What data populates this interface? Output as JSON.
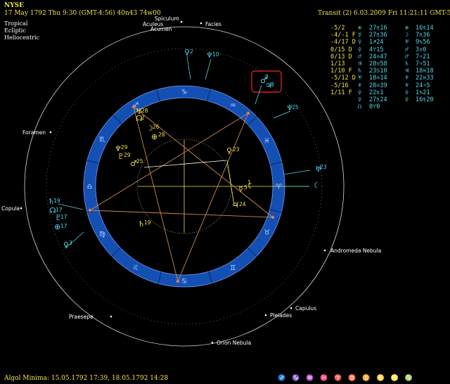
{
  "chart_header": {
    "name": "NYSE",
    "datetime": "17 May 1792   Thu    9:30 (GMT-4:56) 40n43  74w00",
    "options": [
      "Tropical",
      "Ecliptic",
      "Heliocentric"
    ]
  },
  "transit_header": "Transit (2)  6.03.2009  Fri 11:21:11 GMT-5",
  "transit_rows": [
    {
      "aspect": "-5/2",
      "tp": "⊕",
      "tpos": "27♏16",
      "np": "⊕",
      "npos": "16♏14"
    },
    {
      "aspect": "-4/-1 F",
      "tp": "☿",
      "tpos": "27♏36",
      "np": "☽",
      "npos": "7♏36"
    },
    {
      "aspect": "-4/17 D",
      "tp": "♀",
      "tpos": "1♐24",
      "np": "♅",
      "npos": "9♑56"
    },
    {
      "aspect": "0/15 D",
      "tp": "♀",
      "tpos": "4♈15",
      "np": "♂",
      "npos": "3♉0"
    },
    {
      "aspect": "0/13 D",
      "tp": "♂",
      "tpos": "24♎47",
      "np": "♂",
      "npos": "7♒21"
    },
    {
      "aspect": "1/13",
      "tp": "♃",
      "tpos": "28♉58",
      "np": "♄",
      "npos": "7♒51"
    },
    {
      "aspect": "1/10 F",
      "tp": "♄",
      "tpos": "23♋10",
      "np": "♃",
      "npos": "18♓18"
    },
    {
      "aspect": "-5/12 D",
      "tp": "♅",
      "tpos": "18♎14",
      "np": "♆",
      "npos": "22♓33"
    },
    {
      "aspect": "-5/16",
      "tp": "♆",
      "tpos": "28♎39",
      "np": "♆",
      "npos": "24♒5"
    },
    {
      "aspect": "1/11 F",
      "tp": "♀",
      "tpos": "22♏1",
      "np": "♀",
      "npos": "1♑21"
    },
    {
      "aspect": "",
      "tp": "♀",
      "tpos": "27♏24",
      "np": "♀",
      "npos": "16♏20"
    },
    {
      "aspect": "",
      "tp": "☊",
      "tpos": "0♈0",
      "np": "",
      "npos": ""
    }
  ],
  "fixed_stars": [
    "Spiculum",
    "Aculeus",
    "Acumen",
    "Facies",
    "Foramen",
    "Copula",
    "Andromeda Nebula",
    "Capulus",
    "Pleiades",
    "Praesepe",
    "Orion Nebula"
  ],
  "zodiac_ring": [
    "♐",
    "♑",
    "♒",
    "♓",
    "♈",
    "♉",
    "♊",
    "♋",
    "♌",
    "♍",
    "♎",
    "♏"
  ],
  "natal_planets": [
    {
      "glyph": "♅",
      "deg": "28"
    },
    {
      "glyph": "☊",
      "deg": "2"
    },
    {
      "glyph": "☽",
      "deg": "26"
    },
    {
      "glyph": "⊕",
      "deg": "28"
    },
    {
      "glyph": "♆",
      "deg": "29"
    },
    {
      "glyph": "♇",
      "deg": "29"
    },
    {
      "glyph": "♂",
      "deg": "25"
    },
    {
      "glyph": "♀",
      "deg": "23"
    },
    {
      "glyph": "☿",
      "deg": "5"
    },
    {
      "glyph": "☾",
      "deg": "1"
    },
    {
      "glyph": "♃",
      "deg": "24"
    },
    {
      "glyph": "♄",
      "deg": "19"
    }
  ],
  "transit_planets": [
    {
      "glyph": "♀",
      "deg": "2"
    },
    {
      "glyph": "♆",
      "deg": "10"
    },
    {
      "glyph": "♂",
      "deg": "8"
    },
    {
      "glyph": "♃",
      "deg": "8"
    },
    {
      "glyph": "♆",
      "deg": "25"
    },
    {
      "glyph": "♅",
      "deg": "23"
    },
    {
      "glyph": "☾",
      "deg": ""
    },
    {
      "glyph": "♄",
      "deg": "19"
    },
    {
      "glyph": "☊",
      "deg": "17"
    },
    {
      "glyph": "♇",
      "deg": "17"
    },
    {
      "glyph": "⊕",
      "deg": "17"
    },
    {
      "glyph": "♀",
      "deg": "3"
    }
  ],
  "footer": "Algol Minima: 15.05.1792 17:39,  18.05.1792 14:28",
  "footer_glyphs": "♐ ♑ ♒ ♓ ♈ ♉ ♊ ♋ ♌ ♍",
  "colors": {
    "ring": "#1450b4",
    "ring_dark": "#0a3480",
    "natal": "#f2e14a",
    "transit": "#52d5e8",
    "aspect_line": "#c88a5a",
    "highlight_box": "#d02020"
  }
}
